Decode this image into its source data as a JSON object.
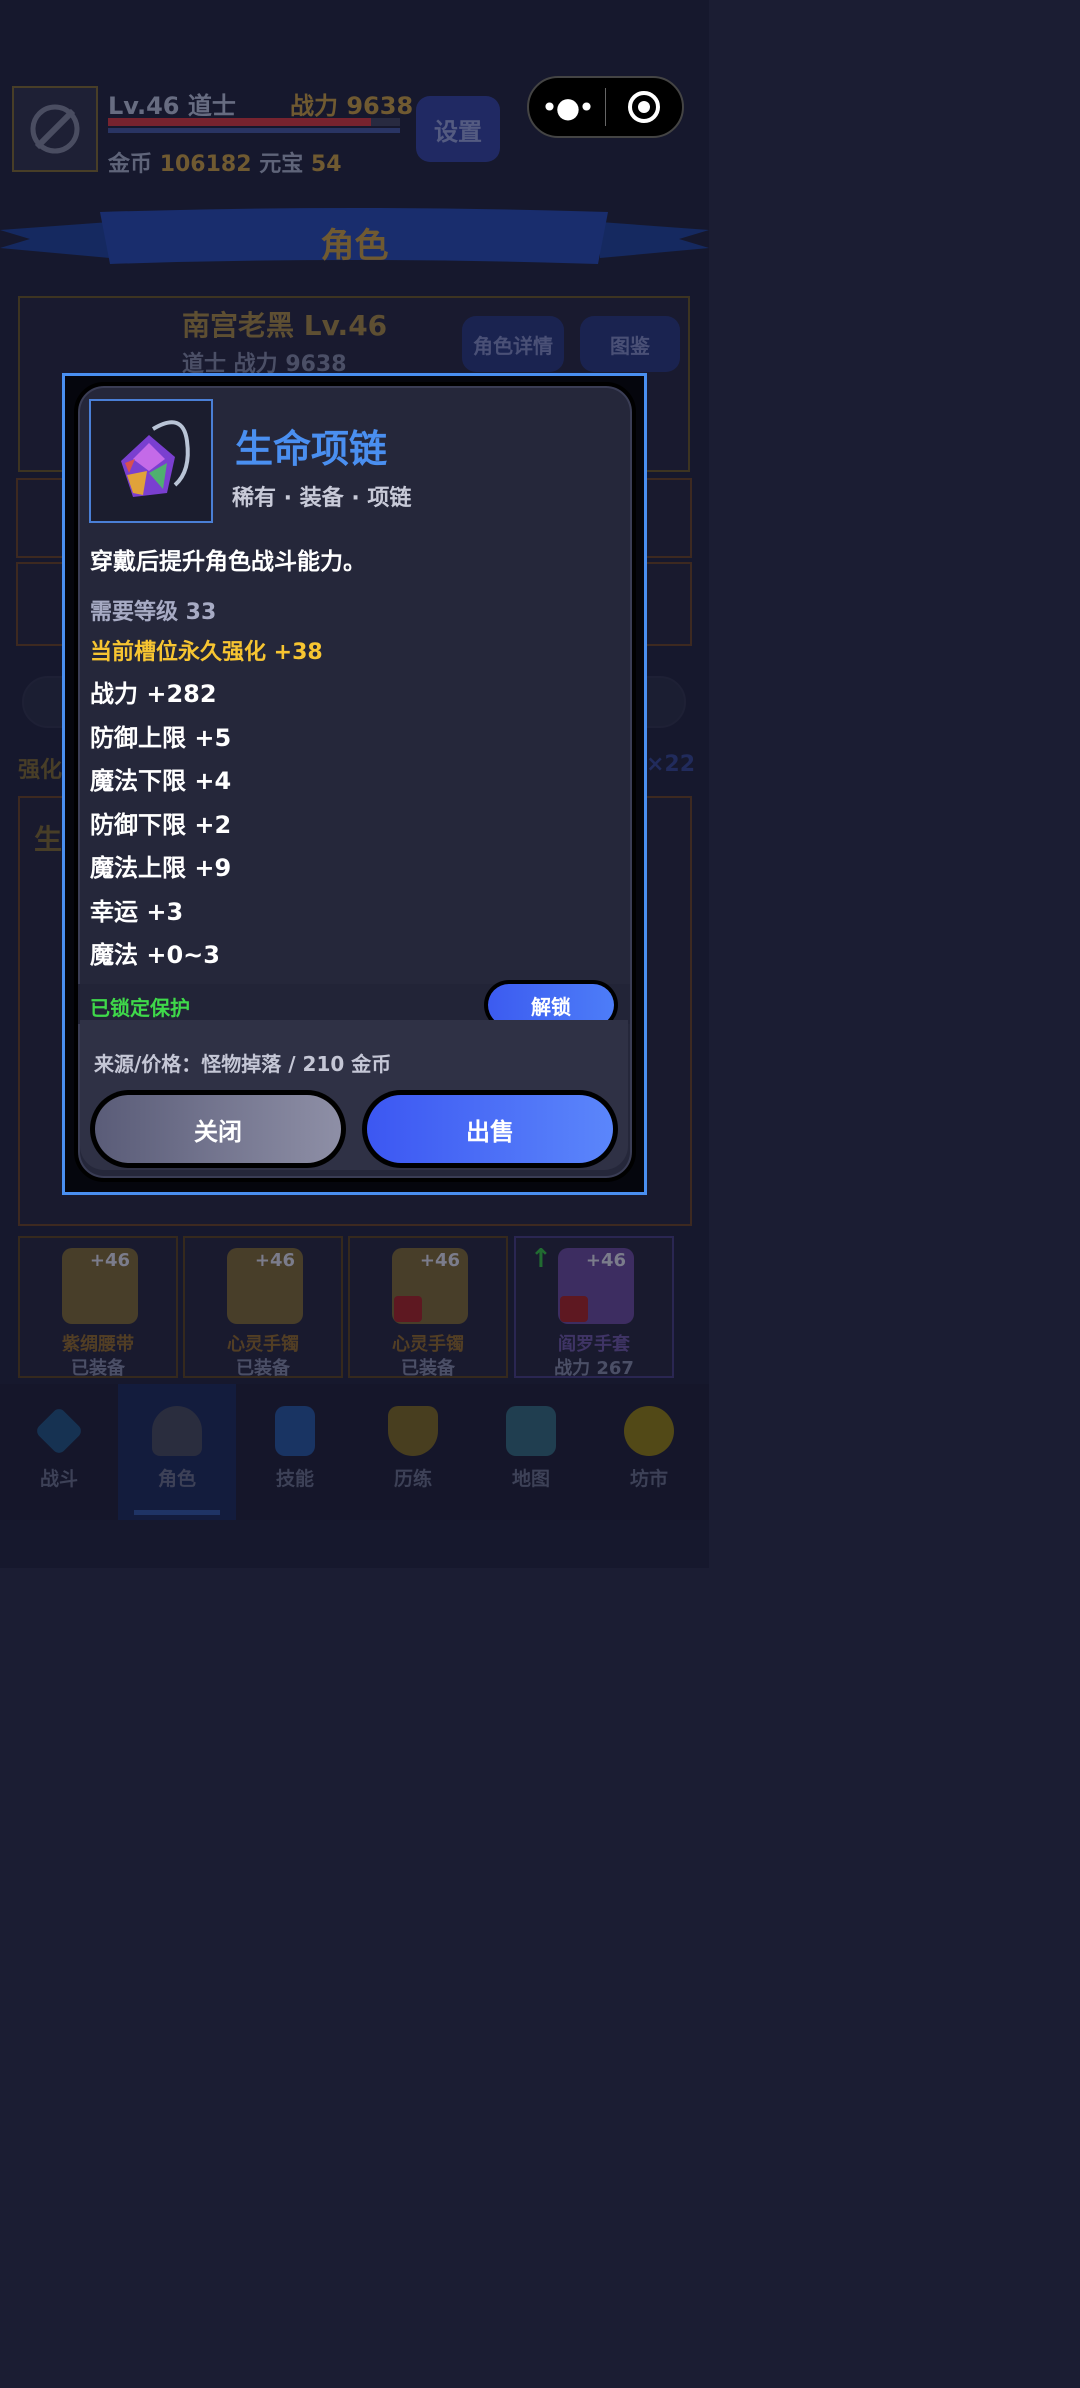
{
  "header": {
    "level": "Lv.46 道士",
    "power": "战力 9638",
    "coins_label": "金币",
    "coins_value": "106182",
    "ingot_label": "元宝",
    "ingot_value": "54",
    "settings": "设置"
  },
  "page_title": "角色",
  "character": {
    "name": "南宫老黑 Lv.46",
    "sub": "道士 战力 9638",
    "details_btn": "角色详情",
    "codex_btn": "图鉴"
  },
  "bg_fragments": {
    "enhance_left": "强化",
    "count_right": "×22",
    "left_gold": "生"
  },
  "modal": {
    "title": "生命项链",
    "tags": "稀有 · 装备 · 项链",
    "description": "穿戴后提升角色战斗能力。",
    "requirement": "需要等级 33",
    "enhancement": "当前槽位永久强化 +38",
    "stats": [
      "战力 +282",
      "防御上限 +5",
      "魔法下限 +4",
      "防御下限 +2",
      "魔法上限 +9",
      "幸运 +3",
      "魔法 +0~3"
    ],
    "locked_text": "已锁定保护",
    "unlock_btn": "解锁",
    "source": "来源/价格：怪物掉落 / 210 金币",
    "close_btn": "关闭",
    "sell_btn": "出售"
  },
  "cards": [
    {
      "plus": "+46",
      "name": "紫绸腰带",
      "status": "已装备"
    },
    {
      "plus": "+46",
      "name": "心灵手镯",
      "status": "已装备"
    },
    {
      "plus": "+46",
      "name": "心灵手镯",
      "status": "已装备"
    },
    {
      "plus": "+46",
      "name": "阎罗手套",
      "status": "战力 267"
    }
  ],
  "nav": [
    {
      "label": "战斗",
      "icon": "sword-icon"
    },
    {
      "label": "角色",
      "icon": "helmet-icon"
    },
    {
      "label": "技能",
      "icon": "potion-icon"
    },
    {
      "label": "历练",
      "icon": "trophy-icon"
    },
    {
      "label": "地图",
      "icon": "map-icon"
    },
    {
      "label": "坊市",
      "icon": "coin-icon"
    }
  ],
  "colors": {
    "accent_blue": "#4a8ff0",
    "gold": "#f7c531",
    "green": "#3fd94a"
  }
}
